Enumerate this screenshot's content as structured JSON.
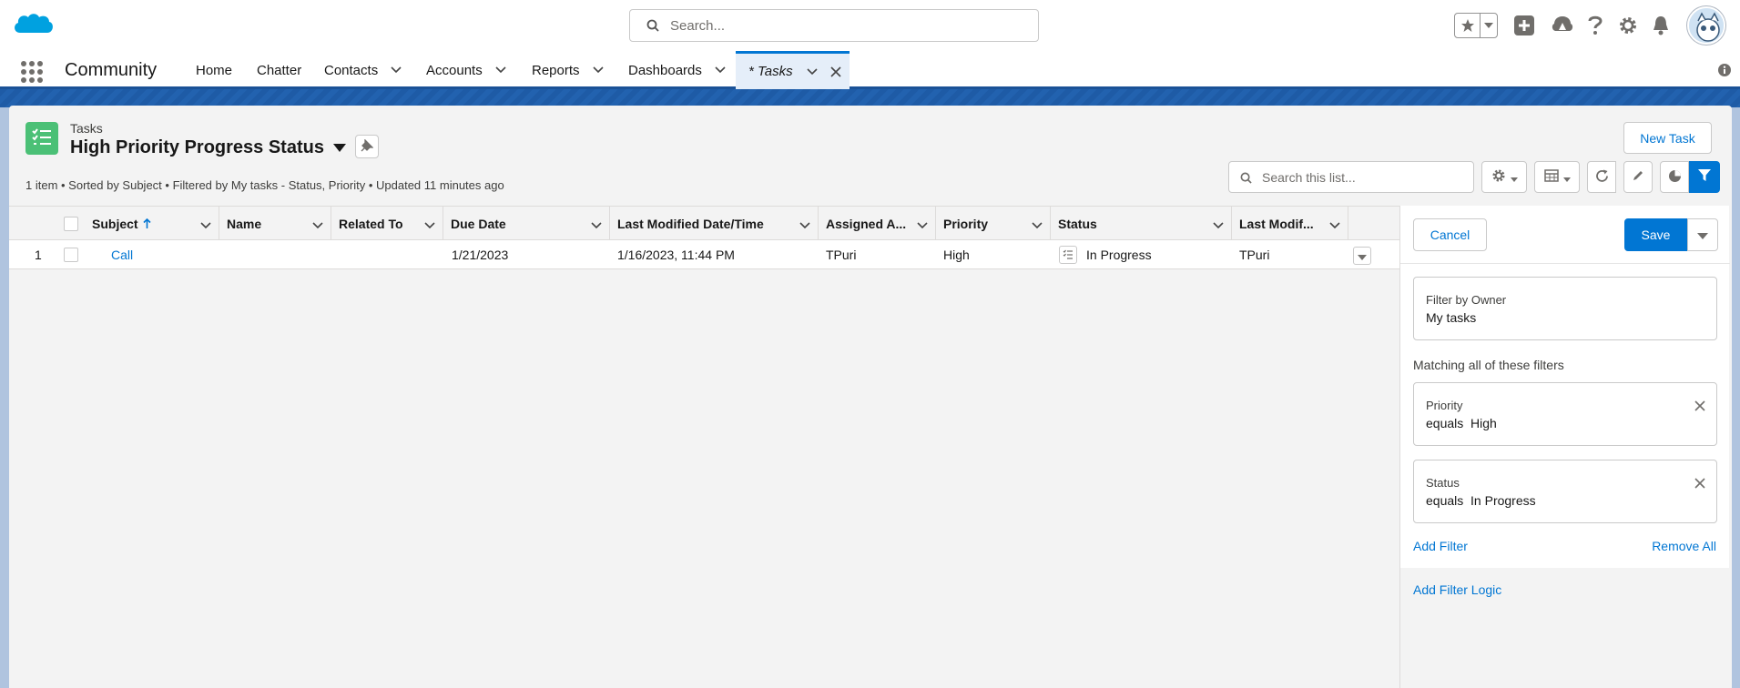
{
  "global_header": {
    "search_placeholder": "Search..."
  },
  "nav": {
    "app_name": "Community",
    "items": [
      {
        "label": "Home",
        "has_menu": false
      },
      {
        "label": "Chatter",
        "has_menu": false
      },
      {
        "label": "Contacts",
        "has_menu": true
      },
      {
        "label": "Accounts",
        "has_menu": true
      },
      {
        "label": "Reports",
        "has_menu": true
      },
      {
        "label": "Dashboards",
        "has_menu": true
      }
    ],
    "active_tab": "* Tasks"
  },
  "list_view": {
    "object_label": "Tasks",
    "title": "High Priority Progress Status",
    "meta": "1 item • Sorted by Subject • Filtered by My tasks - Status, Priority • Updated 11 minutes ago",
    "new_button": "New Task",
    "search_placeholder": "Search this list..."
  },
  "table": {
    "columns": [
      "Subject",
      "Name",
      "Related To",
      "Due Date",
      "Last Modified Date/Time",
      "Assigned A...",
      "Priority",
      "Status",
      "Last Modif..."
    ],
    "sorted_column": "Subject",
    "rows": [
      {
        "num": "1",
        "subject": "Call",
        "name": "",
        "related_to": "",
        "due_date": "1/21/2023",
        "last_modified": "1/16/2023, 11:44 PM",
        "assigned": "TPuri",
        "priority": "High",
        "status": "In Progress",
        "last_modified_by": "TPuri"
      }
    ]
  },
  "filter_panel": {
    "cancel": "Cancel",
    "save": "Save",
    "owner_label": "Filter by Owner",
    "owner_value": "My tasks",
    "matching_label": "Matching all of these filters",
    "filters": [
      {
        "field": "Priority",
        "operator": "equals",
        "value": "High"
      },
      {
        "field": "Status",
        "operator": "equals",
        "value": "In Progress"
      }
    ],
    "add_filter": "Add Filter",
    "remove_all": "Remove All",
    "add_filter_logic": "Add Filter Logic"
  },
  "colors": {
    "brand": "#0176d3",
    "tasks_icon": "#4bc076",
    "nav_border": "#1b5297"
  }
}
